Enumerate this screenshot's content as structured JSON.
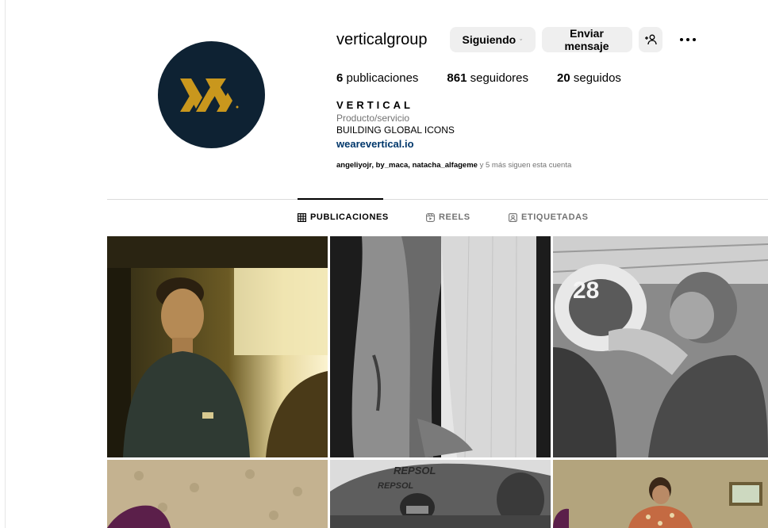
{
  "profile": {
    "username": "verticalgroup",
    "follow_label": "Siguiendo",
    "message_label": "Enviar mensaje",
    "stats": {
      "posts_count": "6",
      "posts_label": "publicaciones",
      "followers_count": "861",
      "followers_label": "seguidores",
      "following_count": "20",
      "following_label": "seguidos"
    },
    "bio": {
      "name": "VERTICAL",
      "category": "Producto/servicio",
      "text": "BUILDING GLOBAL ICONS",
      "link": "wearevertical.io"
    },
    "followed_by": {
      "users": "angeliyojr, by_maca, natacha_alfageme",
      "rest": " y 5 más siguen esta cuenta"
    }
  },
  "tabs": [
    {
      "label": "PUBLICACIONES",
      "active": true
    },
    {
      "label": "REELS",
      "active": false
    },
    {
      "label": "ETIQUETADAS",
      "active": false
    }
  ],
  "colors": {
    "avatar_bg": "#0e2233",
    "logo_gold": "#c9971d",
    "button_bg": "#efefef",
    "link": "#00376b",
    "secondary_text": "#737373"
  },
  "posts": [
    {
      "id": "post-1",
      "tone": "warm"
    },
    {
      "id": "post-2",
      "tone": "bw"
    },
    {
      "id": "post-3",
      "tone": "bw"
    },
    {
      "id": "post-4",
      "tone": "warm"
    },
    {
      "id": "post-5",
      "tone": "bw"
    },
    {
      "id": "post-6",
      "tone": "warm"
    }
  ]
}
